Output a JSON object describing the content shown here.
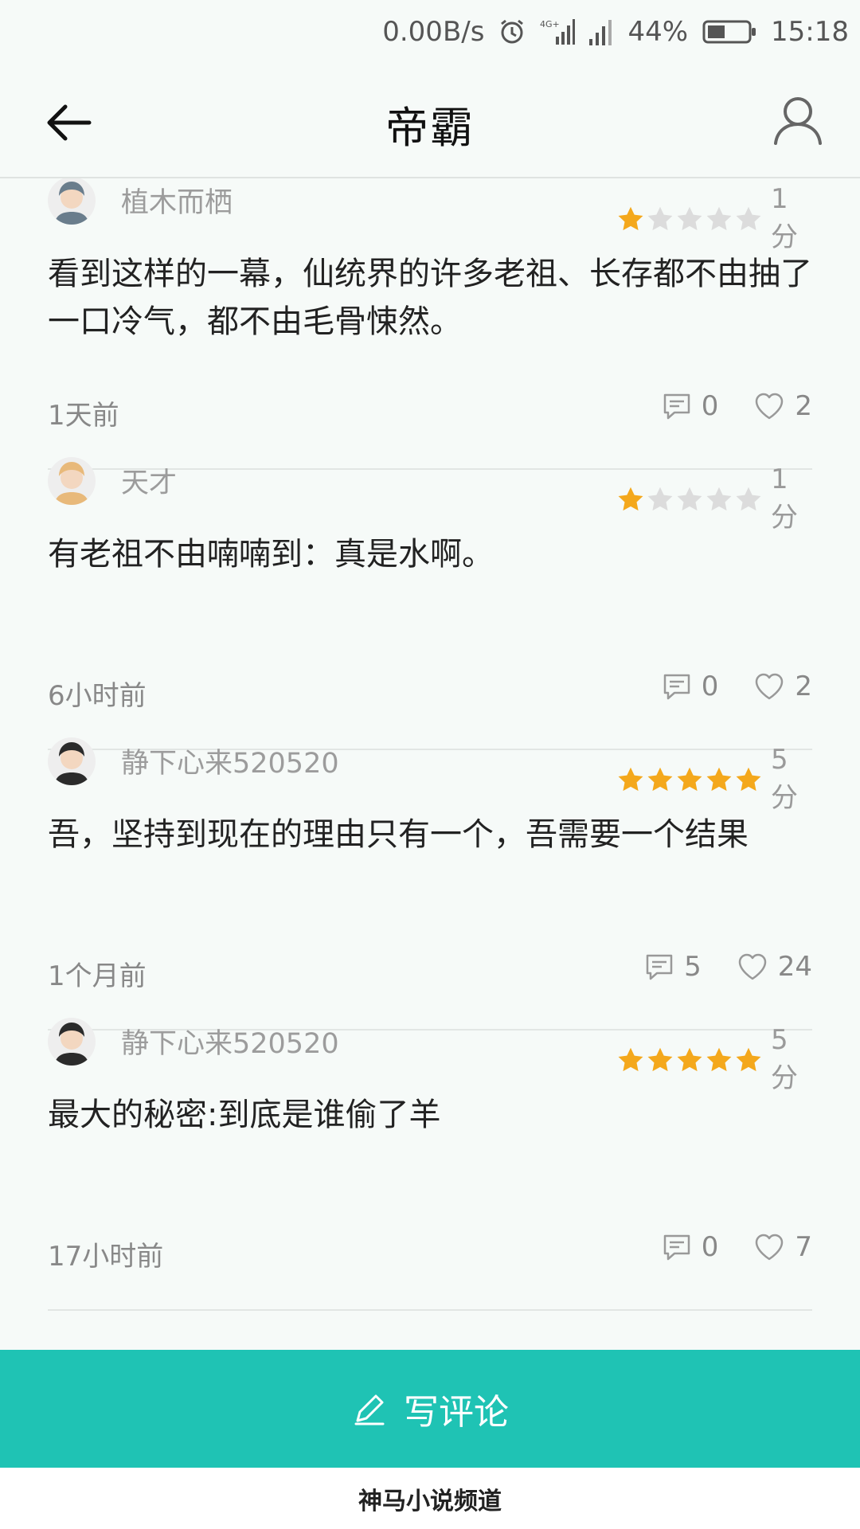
{
  "status_bar": {
    "net_speed": "0.00B/s",
    "network_type": "4G+",
    "battery_percent": "44%",
    "battery_level": 0.44,
    "time": "15:18"
  },
  "header": {
    "title": "帝霸"
  },
  "colors": {
    "accent": "#1fc3b4",
    "star_on": "#f4a81c",
    "star_off": "#dcdcdc"
  },
  "reviews": [
    {
      "username": "植木而栖",
      "stars": 1,
      "score": "1分",
      "content": "看到这样的一幕，仙统界的许多老祖、长存都不由抽了一口冷气，都不由毛骨悚然。",
      "time": "1天前",
      "comments": "0",
      "likes": "2"
    },
    {
      "username": "天才",
      "stars": 1,
      "score": "1分",
      "content": "有老祖不由喃喃到：真是水啊。",
      "time": "6小时前",
      "comments": "0",
      "likes": "2"
    },
    {
      "username": "静下心来520520",
      "stars": 5,
      "score": "5分",
      "content": "吾，坚持到现在的理由只有一个，吾需要一个结果",
      "time": "1个月前",
      "comments": "5",
      "likes": "24"
    },
    {
      "username": "静下心来520520",
      "stars": 5,
      "score": "5分",
      "content": "最大的秘密:到底是谁偷了羊",
      "time": "17小时前",
      "comments": "0",
      "likes": "7"
    }
  ],
  "write_button": {
    "label": "写评论"
  },
  "footer": {
    "label": "神马小说频道"
  }
}
